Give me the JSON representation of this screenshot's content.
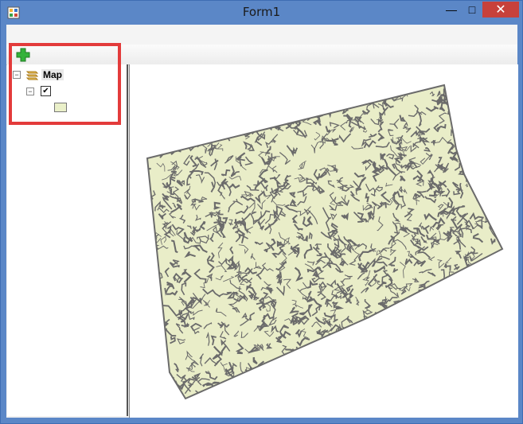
{
  "window": {
    "title": "Form1",
    "minimize_label": "—",
    "maximize_label": "□",
    "close_label": "✕"
  },
  "toolbar": {
    "add_layer_icon": "add-data-icon"
  },
  "toc": {
    "root_label": "Map",
    "layer_checked": true,
    "legend_fill": "#eaf0c9",
    "legend_outline": "#777777"
  },
  "map": {
    "polygon_fill": "#e9edc8",
    "line_color": "#6b6b6b"
  },
  "colors": {
    "highlight_box": "#e33b3b",
    "title_bar": "#5b87c7",
    "close_button": "#c7413b"
  }
}
